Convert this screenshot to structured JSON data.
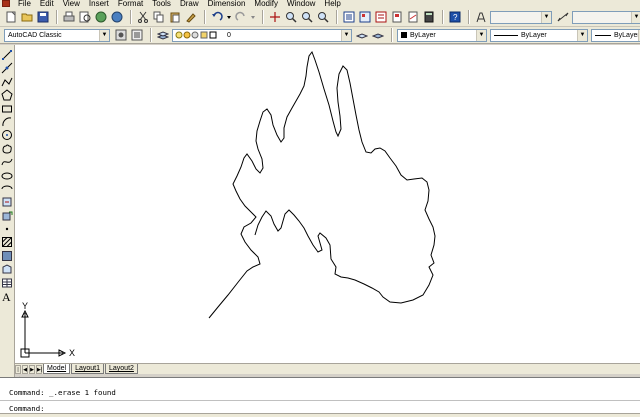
{
  "menubar": {
    "items": [
      "File",
      "Edit",
      "View",
      "Insert",
      "Format",
      "Tools",
      "Draw",
      "Dimension",
      "Modify",
      "Window",
      "Help"
    ]
  },
  "styles_toolbar": {
    "text_style": "",
    "dim_style": "",
    "table_style": ""
  },
  "layers_toolbar": {
    "workspace": "AutoCAD Classic",
    "layer": "0"
  },
  "properties_toolbar": {
    "color": "ByLayer",
    "linetype": "ByLayer",
    "lineweight": "ByLayer"
  },
  "ucs": {
    "x_label": "X",
    "y_label": "Y"
  },
  "layout_tabs": [
    "Model",
    "Layout1",
    "Layout2"
  ],
  "command_window": {
    "line1": "Command: _.erase 1 found",
    "line2": "Command:"
  },
  "colors": {
    "toolbar_bg": "#ece9d8",
    "canvas_bg": "#ffffff",
    "stroke": "#000000",
    "app_red": "#a8321a"
  }
}
